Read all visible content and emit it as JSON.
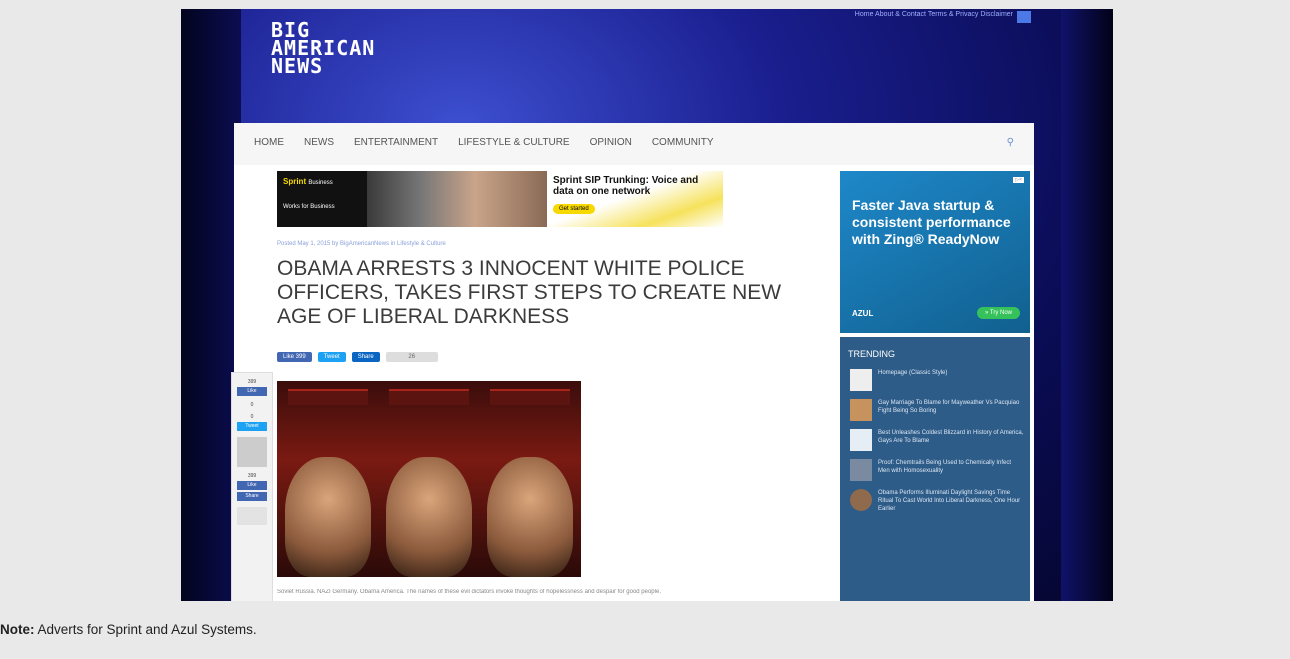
{
  "site": {
    "logo_lines": [
      "BIG",
      "AMERICAN",
      "NEWS"
    ],
    "top_links": "Home  About & Contact  Terms & Privacy  Disclaimer"
  },
  "nav": {
    "items": [
      "HOME",
      "NEWS",
      "ENTERTAINMENT",
      "LIFESTYLE & CULTURE",
      "OPINION",
      "COMMUNITY"
    ]
  },
  "ad_sprint": {
    "brand": "Sprint",
    "brand_sub": "Business",
    "tagline": "Works for Business",
    "headline": "Sprint SIP Trunking: Voice and data on one network",
    "cta": "Get started"
  },
  "article": {
    "meta": "Posted May 1, 2015 by BigAmericanNews in Lifestyle & Culture",
    "headline": "OBAMA ARRESTS 3 INNOCENT WHITE POLICE OFFICERS, TAKES FIRST STEPS TO CREATE NEW AGE OF LIBERAL DARKNESS",
    "share": {
      "like": "Like 399",
      "tweet": "Tweet",
      "share": "Share",
      "count": "26"
    },
    "caption": "Soviet Russia. NAZI Germany. Obama America. The names of these evil dictators invoke thoughts of hopelessness and despair for good people."
  },
  "side_share": {
    "count_top": "399",
    "like": "Like",
    "zero1": "0",
    "zero2": "0",
    "tweet": "Tweet",
    "count_bottom": "399",
    "like2": "Like",
    "share": "Share"
  },
  "ad_azul": {
    "headline": "Faster Java startup & consistent performance with Zing® ReadyNow",
    "logo": "AZUL",
    "cta": "» Try Now"
  },
  "sidebar": {
    "title": "TRENDING",
    "items": [
      "Homepage (Classic Style)",
      "Gay Marriage To Blame for Mayweather Vs Pacquiao Fight Being So Boring",
      "Best Unleashes Coldest Blizzard in History of America, Gays Are To Blame",
      "Proof: Chemtrails Being Used to Chemically Infect Men with Homosexuality",
      "Obama Performs Illuminati Daylight Savings Time Ritual To Cast World Into Liberal Darkness, One Hour Earlier"
    ]
  },
  "note": {
    "label": "Note:",
    "text": " Adverts for Sprint and Azul Systems."
  }
}
